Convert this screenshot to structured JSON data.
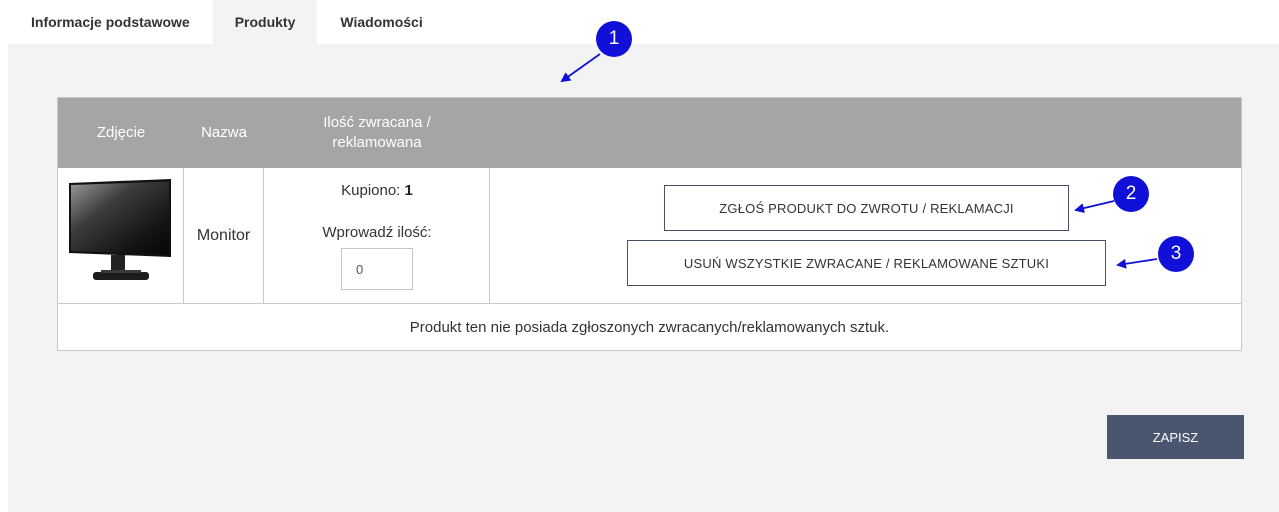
{
  "tabs": [
    {
      "label": "Informacje podstawowe",
      "active": false
    },
    {
      "label": "Produkty",
      "active": true
    },
    {
      "label": "Wiadomości",
      "active": false
    }
  ],
  "table": {
    "headers": {
      "photo": "Zdjęcie",
      "name": "Nazwa",
      "qty_line1": "Ilość zwracana /",
      "qty_line2": "reklamowana"
    },
    "rows": [
      {
        "name": "Monitor",
        "bought_label": "Kupiono:",
        "bought_value": "1",
        "enter_label": "Wprowadź ilość:",
        "qty_value": "0",
        "report_button": "ZGŁOŚ PRODUKT DO ZWROTU / REKLAMACJI",
        "remove_button": "USUŃ WSZYSTKIE ZWRACANE / REKLAMOWANE SZTUKI"
      }
    ],
    "note": "Produkt ten nie posiada zgłoszonych zwracanych/reklamowanych sztuk."
  },
  "save_button": "ZAPISZ",
  "annotations": [
    {
      "number": "1"
    },
    {
      "number": "2"
    },
    {
      "number": "3"
    }
  ],
  "colors": {
    "header_bg": "#a5a5a5",
    "save_bg": "#4a5570",
    "badge": "#1010d8",
    "panel_bg": "#f3f3f3"
  }
}
